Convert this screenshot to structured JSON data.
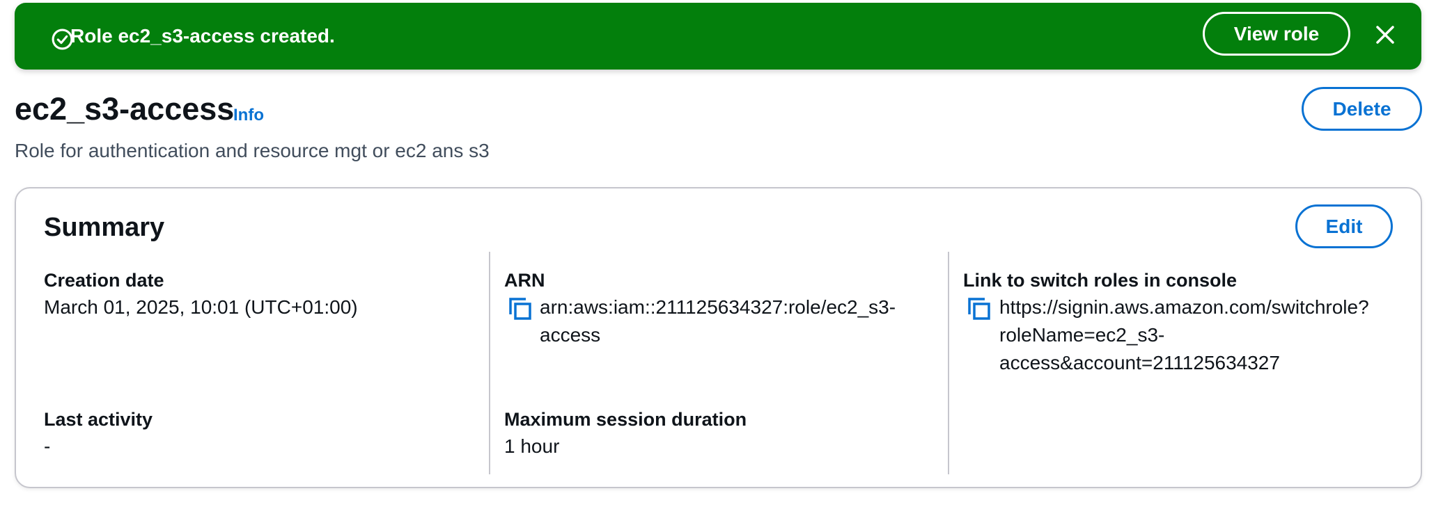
{
  "flash": {
    "message": "Role ec2_s3-access created.",
    "view_role_label": "View role",
    "icon": "check-circle-icon",
    "color": "#037f0c"
  },
  "header": {
    "title": "ec2_s3-access",
    "info_label": "Info",
    "description": "Role for authentication and resource mgt or ec2 ans s3",
    "delete_label": "Delete"
  },
  "summary": {
    "title": "Summary",
    "edit_label": "Edit",
    "creation_date": {
      "label": "Creation date",
      "value": "March 01, 2025, 10:01 (UTC+01:00)"
    },
    "last_activity": {
      "label": "Last activity",
      "value": "-"
    },
    "arn": {
      "label": "ARN",
      "lines": [
        "arn:aws:iam::211125634327:role/ec2_s3-",
        "access"
      ]
    },
    "max_session": {
      "label": "Maximum session duration",
      "value": "1 hour"
    },
    "switch_link": {
      "label": "Link to switch roles in console",
      "lines": [
        "https://signin.aws.amazon.com/switchrole?",
        "roleName=ec2_s3-",
        "access&account=211125634327"
      ]
    }
  },
  "colors": {
    "accent": "#0972d3",
    "success": "#037f0c",
    "border": "#c6c6cd"
  }
}
